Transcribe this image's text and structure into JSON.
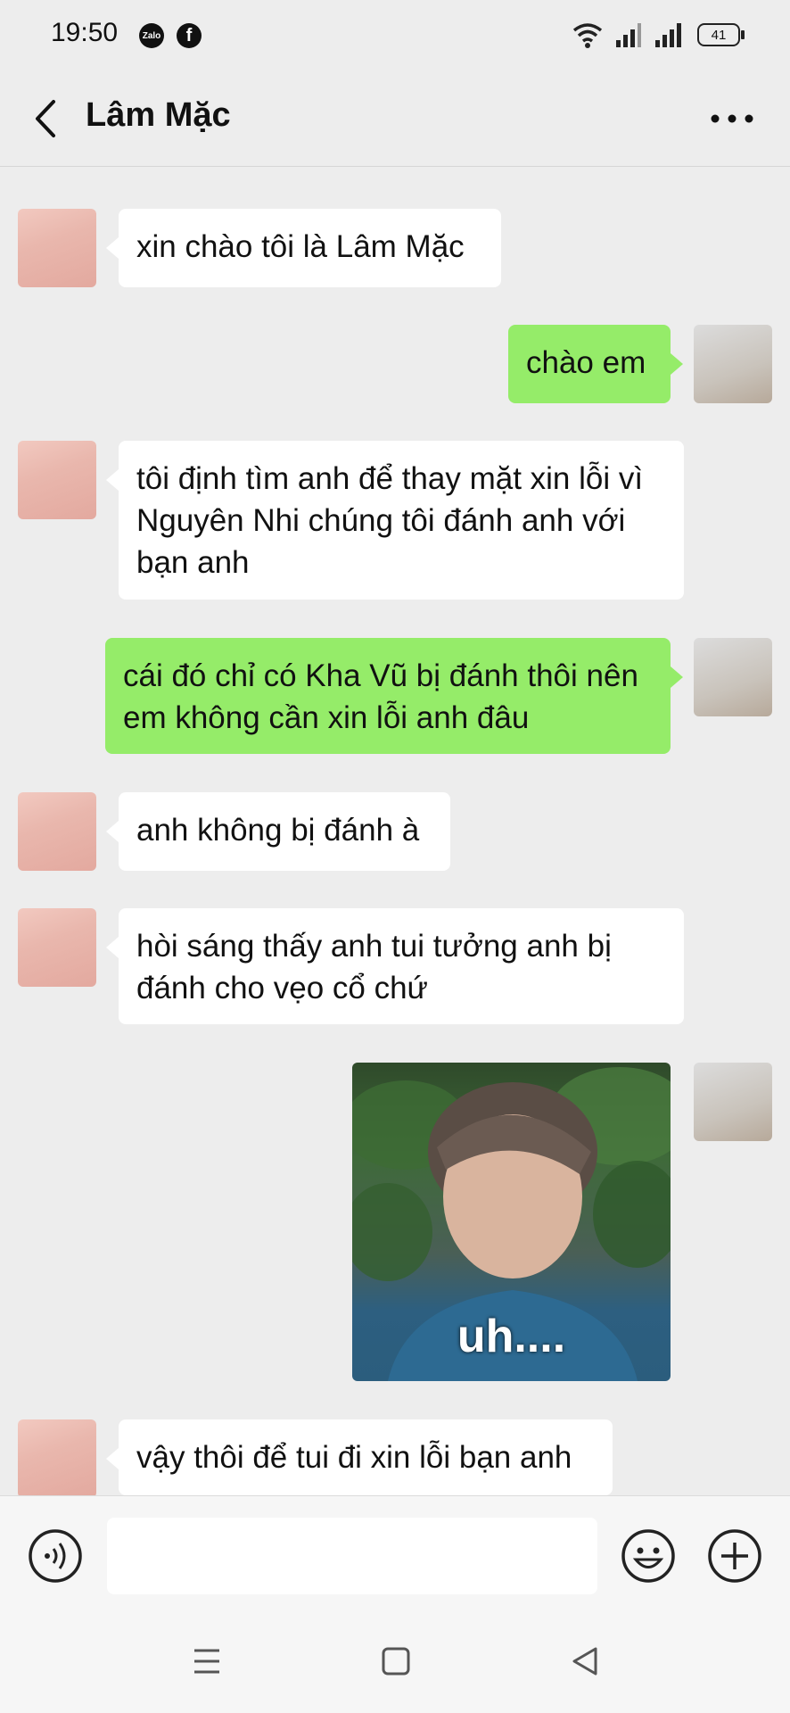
{
  "status_bar": {
    "time": "19:50",
    "app_icons": [
      "zalo-icon",
      "facebook-icon"
    ],
    "zalo_label": "Zalo",
    "facebook_label": "f",
    "battery": "41"
  },
  "header": {
    "title": "Lâm Mặc"
  },
  "messages": [
    {
      "from": "them",
      "text": "xin chào tôi là Lâm Mặc"
    },
    {
      "from": "me",
      "text": "chào em"
    },
    {
      "from": "them",
      "text": "tôi định tìm anh để thay mặt  xin lỗi vì Nguyên Nhi chúng tôi đánh anh với bạn anh"
    },
    {
      "from": "me",
      "text": "cái đó chỉ có Kha Vũ bị đánh thôi nên em không cần xin lỗi anh đâu"
    },
    {
      "from": "them",
      "text": "anh không bị đánh à"
    },
    {
      "from": "them",
      "text": "hòi sáng thấy anh tui tưởng anh bị đánh cho vẹo cổ chứ"
    },
    {
      "from": "me",
      "type": "image",
      "caption": "uh...."
    },
    {
      "from": "them",
      "text": "vậy thôi để tui đi xin lỗi bạn anh"
    }
  ],
  "colors": {
    "outgoing_bubble": "#95ec69",
    "incoming_bubble": "#ffffff",
    "background": "#ededed"
  },
  "input_bar": {
    "value": "",
    "icons": [
      "voice-icon",
      "emoji-icon",
      "add-icon"
    ]
  },
  "nav_bar": {
    "icons": [
      "menu-icon",
      "home-icon",
      "back-nav-icon"
    ]
  }
}
